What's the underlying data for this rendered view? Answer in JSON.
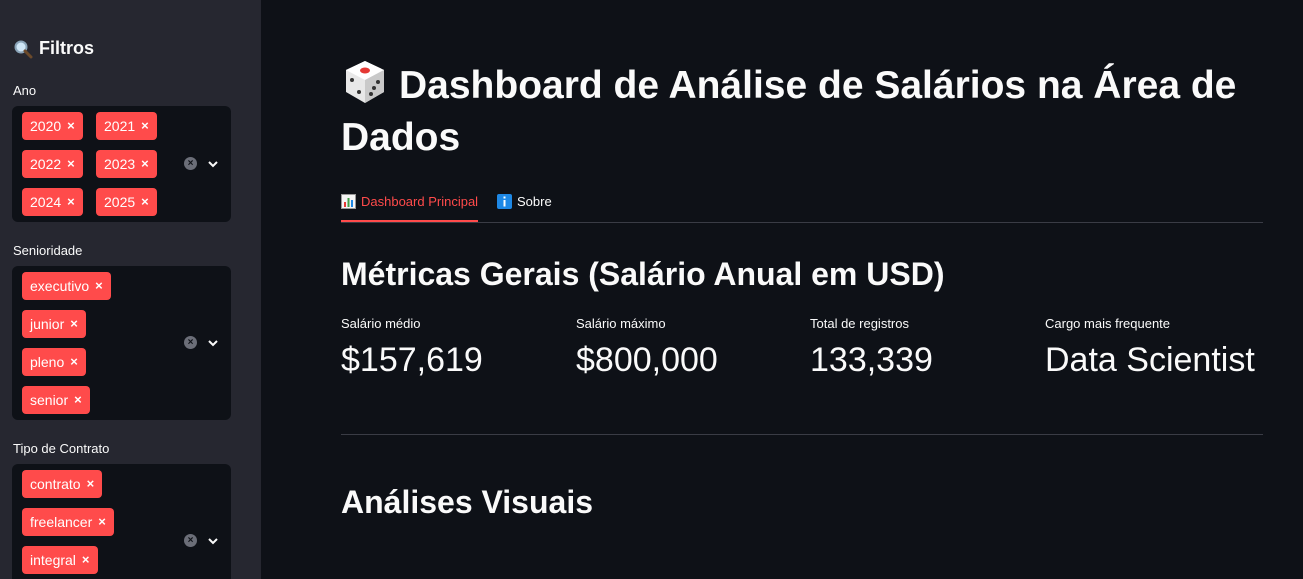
{
  "sidebar": {
    "title": "Filtros",
    "title_icon": "magnifier-icon",
    "filters": [
      {
        "label": "Ano",
        "selected": [
          "2020",
          "2021",
          "2022",
          "2023",
          "2024",
          "2025"
        ]
      },
      {
        "label": "Senioridade",
        "selected": [
          "executivo",
          "junior",
          "pleno",
          "senior"
        ]
      },
      {
        "label": "Tipo de Contrato",
        "selected": [
          "contrato",
          "freelancer",
          "integral"
        ]
      }
    ],
    "remove_glyph": "×",
    "clear_glyph": "×"
  },
  "main": {
    "title": "Dashboard de Análise de Salários na Área de Dados",
    "title_icon": "die-icon",
    "tabs": [
      {
        "label": "Dashboard Principal",
        "icon": "bar-chart-icon",
        "active": true
      },
      {
        "label": "Sobre",
        "icon": "info-icon",
        "active": false
      }
    ],
    "metrics_heading": "Métricas Gerais (Salário Anual em USD)",
    "metrics": [
      {
        "label": "Salário médio",
        "value": "$157,619"
      },
      {
        "label": "Salário máximo",
        "value": "$800,000"
      },
      {
        "label": "Total de registros",
        "value": "133,339"
      },
      {
        "label": "Cargo mais frequente",
        "value": "Data Scientist"
      }
    ],
    "visuals_heading": "Análises Visuais"
  },
  "colors": {
    "accent": "#ff4b4b",
    "background": "#0e1117",
    "sidebar": "#262730"
  }
}
